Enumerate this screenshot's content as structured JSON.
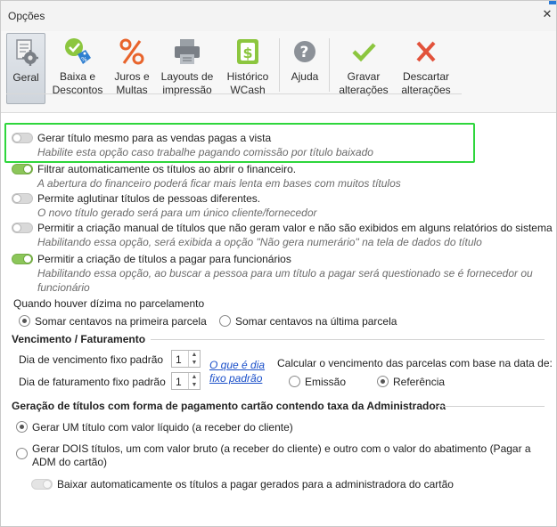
{
  "window": {
    "title": "Opções",
    "close_glyph": "✕"
  },
  "toolbar": {
    "buttons": [
      {
        "label": "Geral",
        "icon": "settings-document-icon",
        "active": true
      },
      {
        "label": "Baixa e Descontos",
        "icon": "check-tag-icon"
      },
      {
        "label": "Juros e Multas",
        "icon": "percent-icon"
      },
      {
        "label": "Layouts de impressão",
        "icon": "printer-icon"
      },
      {
        "label": "Histórico WCash",
        "icon": "dollar-doc-icon"
      },
      {
        "label": "Ajuda",
        "icon": "help-icon"
      },
      {
        "label": "Gravar alterações",
        "icon": "checkmark-icon"
      },
      {
        "label": "Descartar alterações",
        "icon": "x-icon"
      }
    ],
    "labels": {
      "geral": "Geral",
      "baixa_1": "Baixa e",
      "baixa_2": "Descontos",
      "juros_1": "Juros e",
      "juros_2": "Multas",
      "layouts_1": "Layouts de",
      "layouts_2": "impressão",
      "hist_1": "Histórico",
      "hist_2": "WCash",
      "ajuda": "Ajuda",
      "gravar_1": "Gravar",
      "gravar_2": "alterações",
      "desc_1": "Descartar",
      "desc_2": "alterações"
    },
    "colors": {
      "accent_green": "#8cc63f",
      "accent_red": "#e2523b",
      "percent_orange": "#e8642c",
      "gray_icon": "#7a7f86"
    }
  },
  "options": {
    "opt1": {
      "label": "Gerar título mesmo para as vendas pagas a vista",
      "hint": "Habilite esta opção caso trabalhe pagando comissão por título baixado",
      "on": false
    },
    "opt2": {
      "label": "Filtrar automaticamente os títulos ao abrir o financeiro.",
      "hint": "A abertura do financeiro poderá ficar mais lenta em bases com muitos títulos",
      "on": true
    },
    "opt3": {
      "label": "Permite aglutinar títulos de pessoas diferentes.",
      "hint": "O novo título gerado será para um único cliente/fornecedor",
      "on": false
    },
    "opt4": {
      "label": "Permitir a criação manual de títulos que não geram valor e não são exibidos em alguns relatórios do sistema",
      "hint": "Habilitando essa opção, será exibida a opção \"Não gera numerário\" na tela de dados do título",
      "on": false
    },
    "opt5": {
      "label": "Permitir a criação de títulos a pagar para funcionários",
      "hint_1": "Habilitando essa opção, ao buscar a pessoa para um título a pagar será questionado se é fornecedor ou",
      "hint_2": "funcionário",
      "on": true
    }
  },
  "dizima": {
    "label": "Quando houver dízima no parcelamento",
    "option_first": "Somar centavos na primeira parcela",
    "option_last": "Somar centavos na última parcela",
    "selected": "first"
  },
  "vencimento": {
    "title": "Vencimento / Faturamento",
    "dia_venc_label": "Dia de vencimento fixo padrão",
    "dia_venc_value": "1",
    "dia_fat_label": "Dia de faturamento fixo padrão",
    "dia_fat_value": "1",
    "link_1": "O que é dia",
    "link_2": "fixo padrão",
    "calc_label": "Calcular o vencimento das parcelas com base na data de:",
    "emissao": "Emissão",
    "referencia": "Referência",
    "selected": "referencia"
  },
  "cartao": {
    "title": "Geração de títulos com forma de pagamento cartão contendo taxa da Administradora",
    "opt_um": "Gerar UM título com valor líquido (a receber do cliente)",
    "opt_dois_1": "Gerar DOIS títulos, um com valor bruto (a receber do cliente) e outro com o valor do abatimento (Pagar a",
    "opt_dois_2": "ADM do cartão)",
    "selected": "um",
    "baixar_auto": "Baixar automaticamente os títulos a pagar gerados para a administradora do cartão"
  }
}
